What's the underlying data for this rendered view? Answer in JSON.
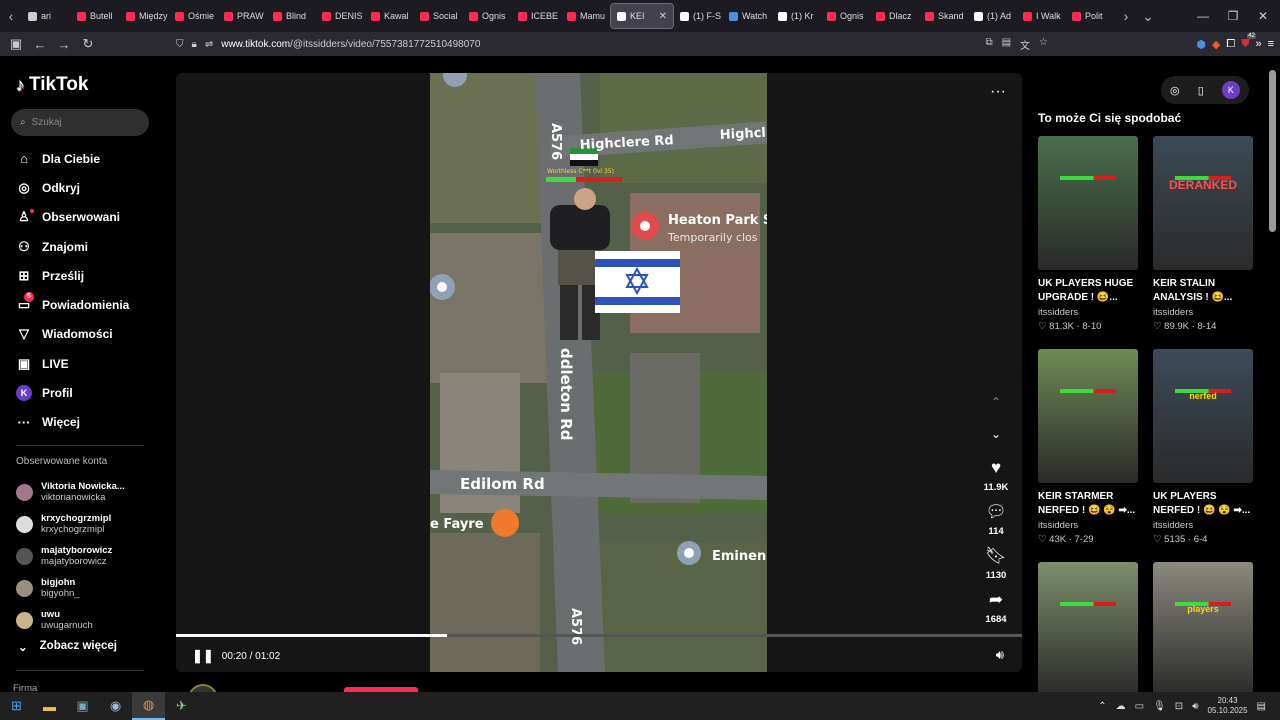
{
  "browser": {
    "tabs": [
      {
        "label": "ari",
        "color": "#cccccc"
      },
      {
        "label": "Butell",
        "color": "#fe2c55"
      },
      {
        "label": "Między",
        "color": "#fe2c55"
      },
      {
        "label": "Ośmie",
        "color": "#fe2c55"
      },
      {
        "label": "PRAW",
        "color": "#fe2c55"
      },
      {
        "label": "Blind",
        "color": "#fe2c55"
      },
      {
        "label": "DENIS",
        "color": "#fe2c55"
      },
      {
        "label": "Kawal",
        "color": "#fe2c55"
      },
      {
        "label": "Social",
        "color": "#fe2c55"
      },
      {
        "label": "Ognis",
        "color": "#fe2c55"
      },
      {
        "label": "ICEBE",
        "color": "#fe2c55"
      },
      {
        "label": "Mamu",
        "color": "#fe2c55"
      },
      {
        "label": "KEI",
        "color": "#ffffff",
        "active": true
      },
      {
        "label": "(1) F-S",
        "color": "#ffffff"
      },
      {
        "label": "Watch",
        "color": "#4a90e2"
      },
      {
        "label": "(1) Kr",
        "color": "#ffffff"
      },
      {
        "label": "Ognis",
        "color": "#fe2c55"
      },
      {
        "label": "Dlacz",
        "color": "#fe2c55"
      },
      {
        "label": "Skand",
        "color": "#fe2c55"
      },
      {
        "label": "(1) Ad",
        "color": "#ffffff"
      },
      {
        "label": "I Walk",
        "color": "#fe2c55"
      },
      {
        "label": "Polit",
        "color": "#fe2c55"
      }
    ],
    "url_host": "www.tiktok.com",
    "url_path": "/@itssidders/video/7557381772510498070",
    "ext_badge": "42"
  },
  "sidebar": {
    "logo": "TikTok",
    "search_placeholder": "Szukaj",
    "menu": [
      {
        "label": "Dla Ciebie",
        "icon": "home-icon",
        "glyph": "⌂"
      },
      {
        "label": "Odkryj",
        "icon": "compass-icon",
        "glyph": "◎"
      },
      {
        "label": "Obserwowani",
        "icon": "following-icon",
        "glyph": "♙"
      },
      {
        "label": "Znajomi",
        "icon": "friends-icon",
        "glyph": "⚇"
      },
      {
        "label": "Prześlij",
        "icon": "upload-icon",
        "glyph": "⊞"
      },
      {
        "label": "Powiadomienia",
        "icon": "notifications-icon",
        "glyph": "▭",
        "badge": "5"
      },
      {
        "label": "Wiadomości",
        "icon": "messages-icon",
        "glyph": "▽"
      },
      {
        "label": "LIVE",
        "icon": "live-icon",
        "glyph": "▣"
      },
      {
        "label": "Profil",
        "icon": "profile-icon",
        "glyph": "K"
      },
      {
        "label": "Więcej",
        "icon": "more-icon",
        "glyph": "···"
      }
    ],
    "followed_title": "Obserwowane konta",
    "followed": [
      {
        "name": "Viktoria Nowicka...",
        "handle": "viktorianowicka",
        "color": "#a0788a"
      },
      {
        "name": "krxychogrzmipl",
        "handle": "krxychogrzmipl",
        "color": "#dddddd"
      },
      {
        "name": "majatyborowicz",
        "handle": "majatyborowicz",
        "color": "#555555"
      },
      {
        "name": "bigjohn",
        "handle": "bigyohn_",
        "color": "#9a8f7e"
      },
      {
        "name": "uwu",
        "handle": "uwugarnuch",
        "color": "#c8b58a"
      }
    ],
    "see_more": "Zobacz więcej",
    "company": "Firma"
  },
  "video": {
    "time": "00:20 / 01:02",
    "progress": 0.32,
    "likes": "11.9K",
    "comments": "114",
    "saves": "1130",
    "shares": "1684",
    "map_labels": {
      "road_a576_top": "A576",
      "highclere": "Highclere Rd",
      "highcl": "Highcl",
      "heaton": "Heaton Park S",
      "temporarily": "Temporarily clos",
      "middleton": "ddleton Rd",
      "edilom": "Edilom Rd",
      "fayre": "e Fayre",
      "eminent": "Eminen",
      "road_a576_bottom": "A576",
      "health_tag": "Worthless C**t (lvl 35)"
    }
  },
  "creator": {
    "name": "itssidders"
  },
  "recommendations": {
    "title": "To może Ci się spodobać",
    "cards": [
      {
        "title": "UK PLAYERS HUGE UPGRADE ! 😆...",
        "author": "itssidders",
        "stats": "♡ 81.3K · 8-10",
        "bg": "#4a6e4a",
        "overlay": "",
        "overlay_color": "#e33"
      },
      {
        "title": "KEIR STALIN ANALYSIS ! 😆...",
        "author": "itssidders",
        "stats": "♡ 89.9K · 8-14",
        "bg": "#3c4a55",
        "overlay": "DERANKED",
        "overlay_color": "#ff4d4d"
      },
      {
        "title": "KEIR STARMER NERFED ! 😆 😵 ➡...",
        "author": "itssidders",
        "stats": "♡ 43K · 7-29",
        "bg": "#6f8a55",
        "overlay": "",
        "overlay_color": "#e33"
      },
      {
        "title": "UK PLAYERS NERFED ! 😆 😵 ➡...",
        "author": "itssidders",
        "stats": "♡ 5135 · 6-4",
        "bg": "#3d4b58",
        "overlay": "nerfed",
        "overlay_color": "#ffd700"
      },
      {
        "title": "",
        "author": "",
        "stats": "",
        "bg": "#7d8f6a",
        "overlay": "",
        "overlay_color": "#ffd700"
      },
      {
        "title": "",
        "author": "",
        "stats": "",
        "bg": "#8b8a7e",
        "overlay": "players",
        "overlay_color": "#ffd700"
      }
    ]
  },
  "taskbar": {
    "time": "20:43",
    "date": "05.10.2025"
  }
}
